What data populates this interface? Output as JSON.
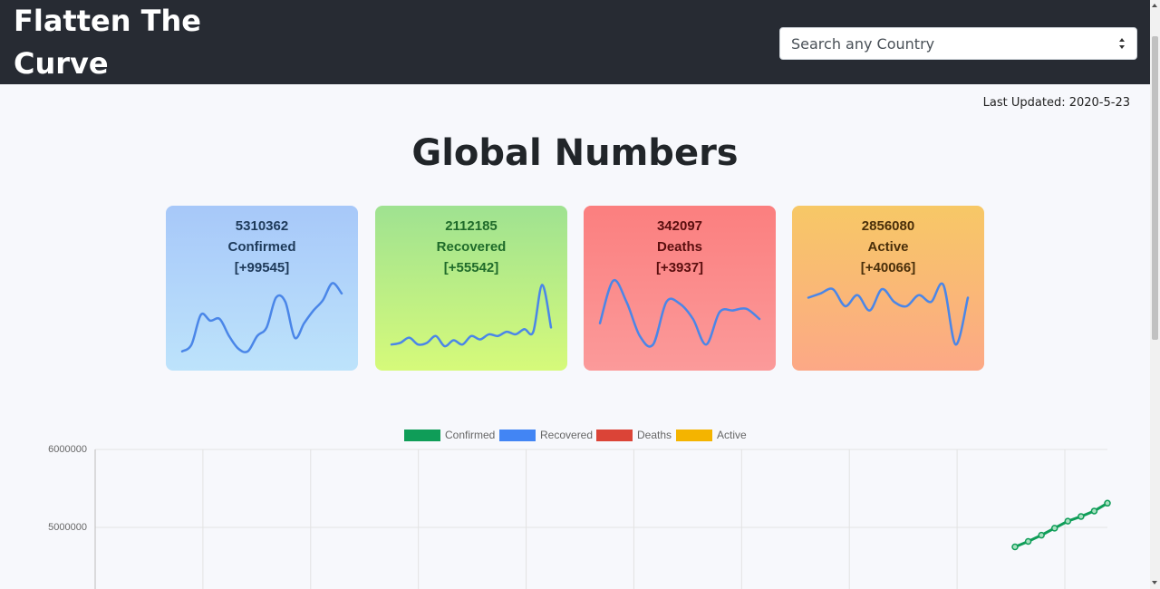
{
  "header": {
    "brand": "Flatten The Curve",
    "search": {
      "placeholder": "Search any Country",
      "icon": "select-arrows-icon"
    }
  },
  "last_updated": "Last Updated: 2020-5-23",
  "heading": "Global Numbers",
  "cards": [
    {
      "id": "confirmed",
      "number": "5310362",
      "label": "Confirmed",
      "delta": "[+99545]",
      "sparkline": [
        0.12,
        0.2,
        0.55,
        0.48,
        0.5,
        0.3,
        0.15,
        0.12,
        0.3,
        0.4,
        0.75,
        0.7,
        0.28,
        0.45,
        0.6,
        0.72,
        0.92,
        0.8
      ]
    },
    {
      "id": "recovered",
      "number": "2112185",
      "label": "Recovered",
      "delta": "[+55542]",
      "sparkline": [
        0.2,
        0.22,
        0.28,
        0.2,
        0.22,
        0.3,
        0.18,
        0.25,
        0.2,
        0.3,
        0.26,
        0.32,
        0.3,
        0.35,
        0.32,
        0.38,
        0.35,
        0.9,
        0.4
      ]
    },
    {
      "id": "deaths",
      "number": "342097",
      "label": "Deaths",
      "delta": "[+3937]",
      "sparkline": [
        0.45,
        0.95,
        0.7,
        0.3,
        0.2,
        0.7,
        0.68,
        0.5,
        0.2,
        0.58,
        0.6,
        0.62,
        0.5
      ]
    },
    {
      "id": "active",
      "number": "2856080",
      "label": "Active",
      "delta": "[+40066]",
      "sparkline": [
        0.75,
        0.8,
        0.85,
        0.65,
        0.78,
        0.6,
        0.85,
        0.7,
        0.65,
        0.78,
        0.7,
        0.9,
        0.2,
        0.75
      ]
    }
  ],
  "chart_data": {
    "type": "line",
    "legend": [
      {
        "name": "Confirmed",
        "color": "#0f9d58"
      },
      {
        "name": "Recovered",
        "color": "#4285f4"
      },
      {
        "name": "Deaths",
        "color": "#db4437"
      },
      {
        "name": "Active",
        "color": "#f4b400"
      }
    ],
    "yticks": [
      "6000000",
      "5000000"
    ],
    "ylim": [
      4200000,
      6000000
    ],
    "grid": true,
    "series": [
      {
        "name": "Confirmed",
        "values": [
          4750000,
          4820000,
          4900000,
          4990000,
          5080000,
          5140000,
          5210000,
          5310362
        ]
      }
    ]
  },
  "colors": {
    "navbar": "#272b33",
    "background": "#f7f8fc"
  }
}
